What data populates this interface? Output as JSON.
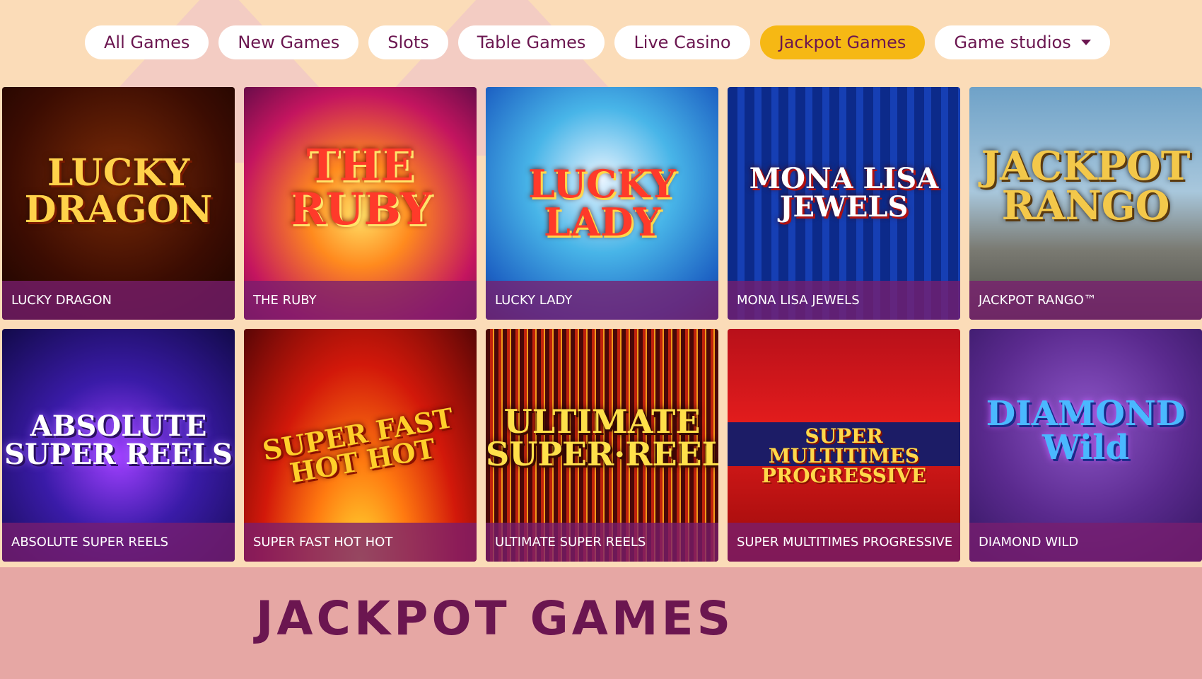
{
  "filters": [
    {
      "label": "All Games",
      "active": false
    },
    {
      "label": "New Games",
      "active": false
    },
    {
      "label": "Slots",
      "active": false
    },
    {
      "label": "Table Games",
      "active": false
    },
    {
      "label": "Live Casino",
      "active": false
    },
    {
      "label": "Jackpot Games",
      "active": true
    },
    {
      "label": "Game studios",
      "active": false,
      "dropdown": true
    }
  ],
  "games": [
    {
      "title": "LUCKY DRAGON",
      "logo": "LUCKY\nDRAGON"
    },
    {
      "title": "THE RUBY",
      "logo": "THE\nRUBY"
    },
    {
      "title": "LUCKY LADY",
      "logo": "LUCKY\nLADY"
    },
    {
      "title": "MONA LISA JEWELS",
      "logo": "MONA LISA\nJEWELS"
    },
    {
      "title": "JACKPOT RANGO™",
      "logo": "JACKPOT\nRANGO"
    },
    {
      "title": "ABSOLUTE SUPER REELS",
      "logo": "ABSOLUTE\nSUPER REELS"
    },
    {
      "title": "SUPER FAST HOT HOT",
      "logo": "SUPER FAST\nHOT HOT"
    },
    {
      "title": "ULTIMATE SUPER REELS",
      "logo": "ULTIMATE\nSUPER·REELS"
    },
    {
      "title": "SUPER MULTITIMES PROGRESSIVE",
      "logo": "SUPER MULTITIMES\nPROGRESSIVE"
    },
    {
      "title": "DIAMOND WILD",
      "logo": "DIAMOND\nWild"
    }
  ],
  "heading": "JACKPOT GAMES",
  "colors": {
    "accent": "#f6b814",
    "brand": "#6b1650",
    "background": "#fbdcb8",
    "band": "#e6a7a4"
  }
}
